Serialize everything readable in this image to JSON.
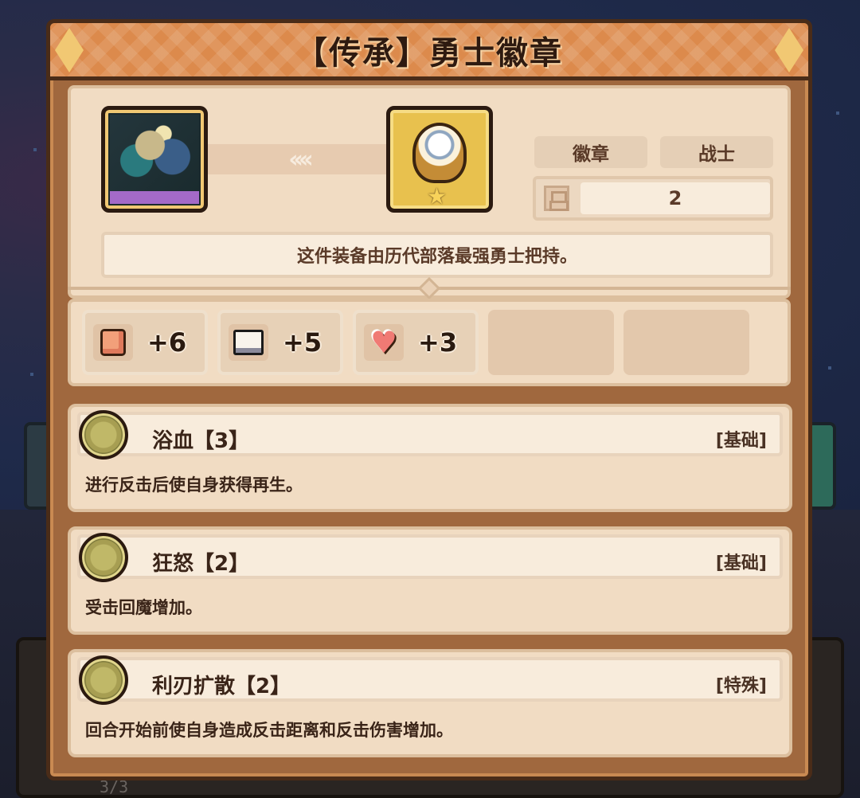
{
  "background": {
    "counter_text": "3/3"
  },
  "panel": {
    "title": "【传承】勇士徽章"
  },
  "item": {
    "arrow_glyphs": "‹‹‹‹",
    "type_tag": "徽章",
    "class_tag": "战士",
    "level_icon": "stack-icon",
    "level_value": "2",
    "description": "这件装备由历代部落最强勇士把持。"
  },
  "stats": [
    {
      "icon": "fist-icon",
      "value": "+6"
    },
    {
      "icon": "book-icon",
      "value": "+5"
    },
    {
      "icon": "heart-icon",
      "value": "+3"
    }
  ],
  "skills": [
    {
      "name": "浴血【3】",
      "tag": "[基础]",
      "description": "进行反击后使自身获得再生。"
    },
    {
      "name": "狂怒【2】",
      "tag": "[基础]",
      "description": "受击回魔增加。"
    },
    {
      "name": "利刃扩散【2】",
      "tag": "[特殊]",
      "description": "回合开始前使自身造成反击距离和反击伤害增加。"
    }
  ],
  "colors": {
    "title_bar": "#dc8a4c",
    "panel_frame": "#a0683e",
    "card_bg": "#f1dcc3",
    "text_dark": "#3a2418"
  }
}
